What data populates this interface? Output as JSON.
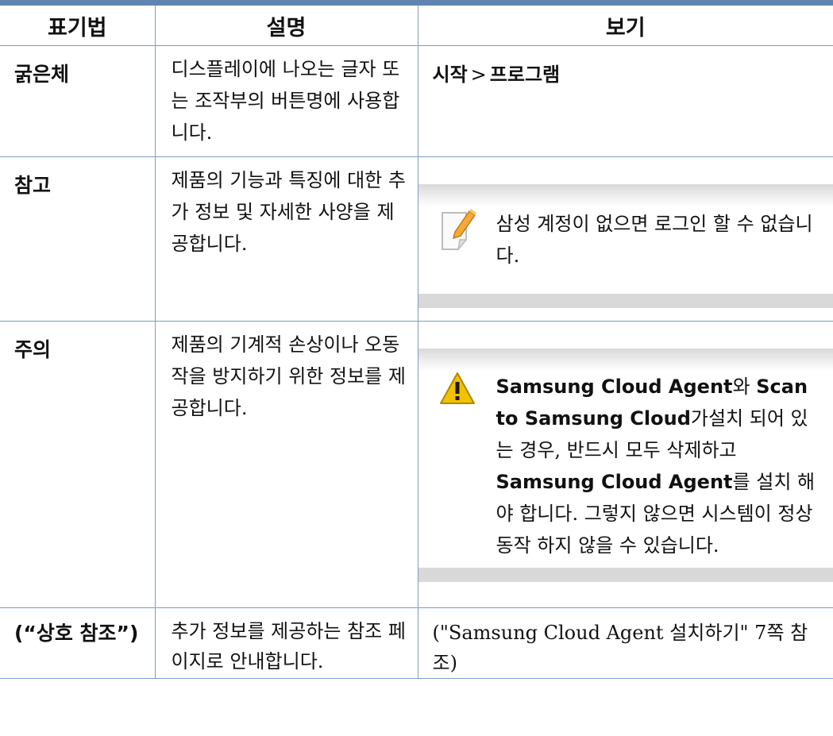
{
  "table": {
    "headers": [
      "표기법",
      "설명",
      "보기"
    ],
    "rows": [
      {
        "label": "굵은체",
        "description": "디스플레이에 나오는 글자 또는 조작부의 버튼명에 사용합니다.",
        "example": {
          "part1": "시작",
          "separator": ">",
          "part2": "프로그램"
        }
      },
      {
        "label": "참고",
        "description": "제품의 기능과 특징에 대한 추가 정보 및 자세한 사양을 제공합니다.",
        "example": {
          "icon": "note-pencil-icon",
          "text": "삼성 계정이 없으면 로그인 할 수 없습니다."
        }
      },
      {
        "label": "주의",
        "description": "제품의 기계적 손상이나 오동작을 방지하기 위한 정보를 제공합니다.",
        "example": {
          "icon": "warning-triangle-icon",
          "t1": "Samsung Cloud Agent",
          "t2": "와 ",
          "t3": "Scan to Samsung Cloud",
          "t4": "가설치 되어 있는 경우, 반드시 모두 삭제하고 ",
          "t5": "Samsung Cloud Agent",
          "t6": "를 설치 해야 합니다. 그렇지 않으면 시스템이 정상 동작 하지 않을 수 있습니다."
        }
      },
      {
        "label": "(“상호 참조”)",
        "description": "추가 정보를 제공하는 참조 페이지로 안내합니다.",
        "example": {
          "text": "(\"Samsung Cloud Agent 설치하기\" 7쪽 참조)"
        }
      }
    ]
  },
  "colors": {
    "rule": "#5f84b2",
    "border": "#7d9cc4",
    "warning": "#f2c200"
  }
}
